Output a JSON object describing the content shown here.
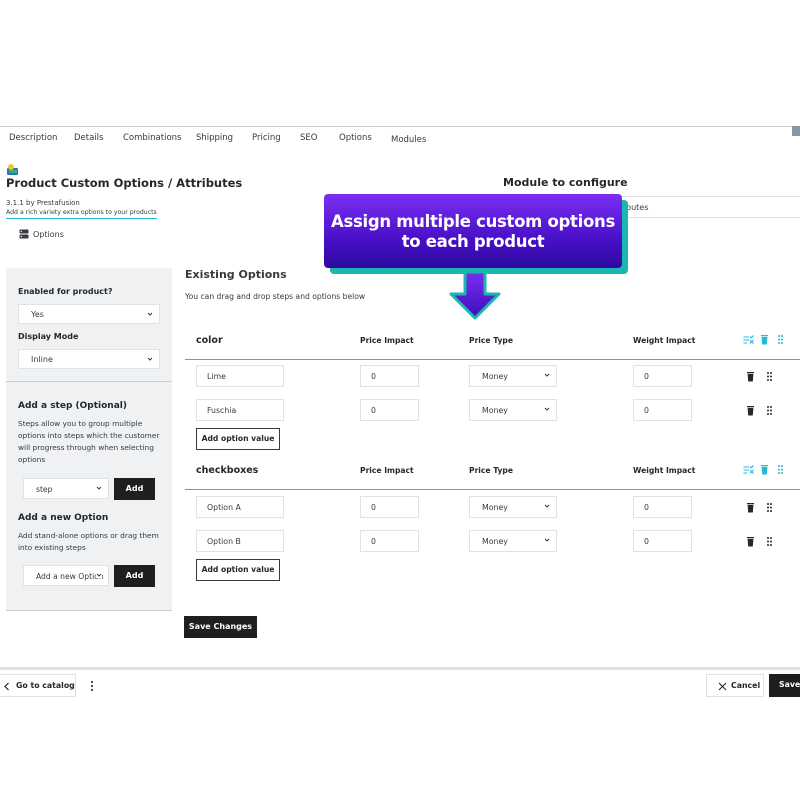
{
  "tabs": [
    "Description",
    "Details",
    "Combinations",
    "Shipping",
    "Pricing",
    "SEO",
    "Options",
    "Modules"
  ],
  "module": {
    "title": "Product Custom Options / Attributes",
    "version": "3.1.1 by Prestafusion",
    "description": "Add a rich variety extra options to your products",
    "options_link": "Options"
  },
  "configure": {
    "title": "Module to configure",
    "selected": "butes"
  },
  "callout": {
    "line1": "Assign multiple custom options",
    "line2": "to each product"
  },
  "sidebar": {
    "enabled_label": "Enabled for product?",
    "enabled_value": "Yes",
    "display_label": "Display Mode",
    "display_value": "Inline",
    "step_heading": "Add a step (Optional)",
    "step_text": "Steps allow you to group multiple options into steps which the customer will progress through when selecting options",
    "step_select": "step",
    "step_add": "Add",
    "option_heading": "Add a new Option",
    "option_text": "Add stand-alone options or drag them into existing steps",
    "option_select": "Add a new Option",
    "option_add": "Add"
  },
  "main": {
    "title": "Existing Options",
    "subtitle": "You can drag and drop steps and options below",
    "columns": {
      "price_impact": "Price Impact",
      "price_type": "Price Type",
      "weight_impact": "Weight Impact"
    },
    "groups": [
      {
        "name": "color",
        "rows": [
          {
            "value": "Lime",
            "price": "0",
            "type": "Money",
            "weight": "0"
          },
          {
            "value": "Fuschia",
            "price": "0",
            "type": "Money",
            "weight": "0"
          }
        ],
        "add_label": "Add option value"
      },
      {
        "name": "checkboxes",
        "rows": [
          {
            "value": "Option A",
            "price": "0",
            "type": "Money",
            "weight": "0"
          },
          {
            "value": "Option B",
            "price": "0",
            "type": "Money",
            "weight": "0"
          }
        ],
        "add_label": "Add option value"
      }
    ],
    "save_changes": "Save Changes"
  },
  "footer": {
    "back": "Go to catalog",
    "cancel": "Cancel",
    "save": "Save and"
  },
  "colors": {
    "accent": "#25b9d7",
    "callout_top": "#7b2ff2",
    "callout_bottom": "#2e0aa0",
    "callout_shadow": "#1ab7b0",
    "dark_button": "#1f1f1f"
  }
}
